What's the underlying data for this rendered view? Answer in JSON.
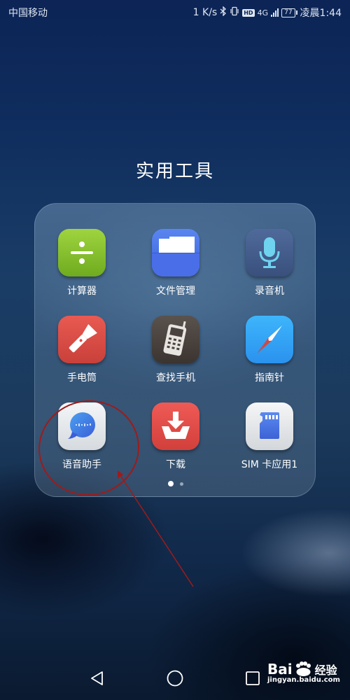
{
  "status_bar": {
    "carrier": "中国移动",
    "net_speed": "1 K/s",
    "bluetooth_icon": "bluetooth-icon",
    "vibrate_icon": "vibrate-icon",
    "hd_badge": "HD",
    "network_type": "4G",
    "battery_level": "77",
    "time": "凌晨1:44"
  },
  "folder": {
    "title": "实用工具",
    "apps": [
      {
        "label": "计算器",
        "icon": "calculator-icon",
        "color": "#8cc63f"
      },
      {
        "label": "文件管理",
        "icon": "file-manager-icon",
        "color": "#4a74e6"
      },
      {
        "label": "录音机",
        "icon": "microphone-icon",
        "color": "#445d8c"
      },
      {
        "label": "手电筒",
        "icon": "flashlight-icon",
        "color": "#dd4e47"
      },
      {
        "label": "查找手机",
        "icon": "find-phone-icon",
        "color": "#4a423e"
      },
      {
        "label": "指南针",
        "icon": "compass-icon",
        "color": "#34a4f5"
      },
      {
        "label": "语音助手",
        "icon": "voice-assistant-icon",
        "color": "#3e7de0"
      },
      {
        "label": "下载",
        "icon": "download-icon",
        "color": "#e04d48"
      },
      {
        "label": "SIM 卡应用1",
        "icon": "sim-card-icon",
        "color": "#4a7ae8"
      }
    ],
    "page_indicator": {
      "current": 1,
      "total": 2
    }
  },
  "annotation": {
    "highlighted_app": "语音助手",
    "color": "#9e1b1b"
  },
  "nav_bar": {
    "back": "back-icon",
    "home": "home-icon",
    "recents": "recents-icon"
  },
  "watermark": {
    "brand_left": "Bai",
    "brand_paw": "du",
    "brand_right": "经验",
    "url": "jingyan.baidu.com"
  }
}
